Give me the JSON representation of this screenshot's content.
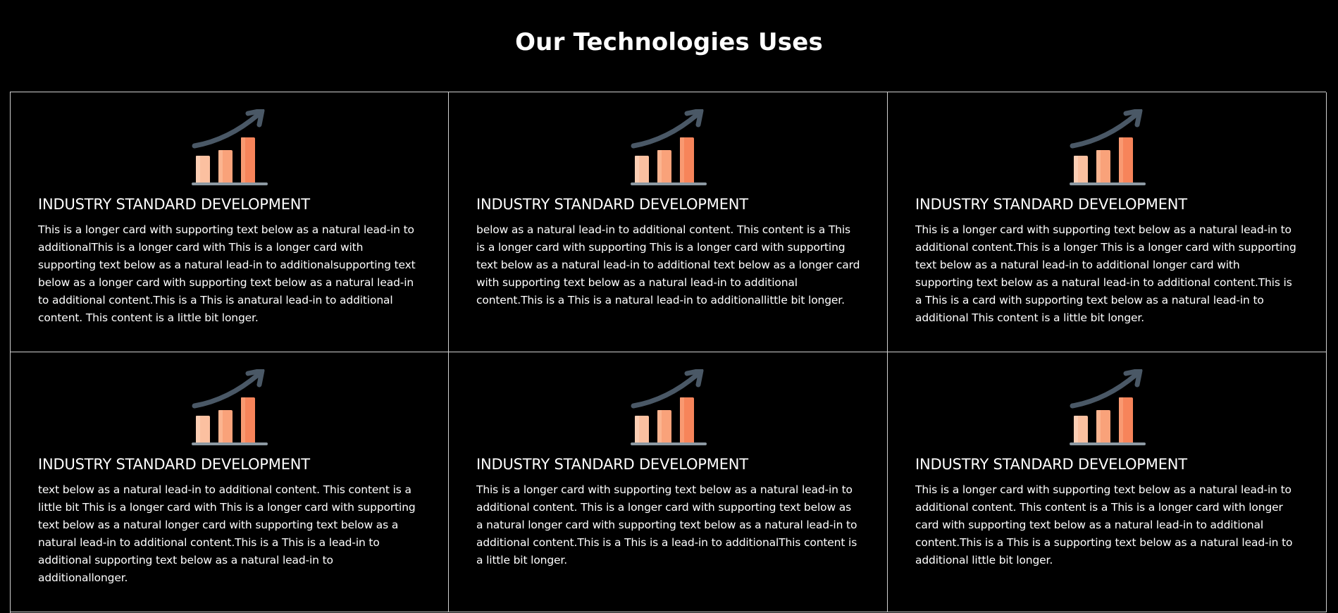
{
  "section": {
    "title": "Our Technologies Uses"
  },
  "cards": [
    {
      "icon": "growth-chart-icon",
      "title": "INDUSTRY STANDARD DEVELOPMENT",
      "text": "This is a longer card with supporting text below as a natural lead-in to additionalThis is a longer card with This is a longer card with supporting text below as a natural lead-in to additionalsupporting text below as a longer card with supporting text below as a natural lead-in to additional content.This is a This is anatural lead-in to additional content. This content is a little bit longer."
    },
    {
      "icon": "growth-chart-icon",
      "title": "INDUSTRY STANDARD DEVELOPMENT",
      "text": "below as a natural lead-in to additional content. This content is a This is a longer card with supporting This is a longer card with supporting text below as a natural lead-in to additional text below as a longer card with supporting text below as a natural lead-in to additional content.This is a This is a natural lead-in to additionallittle bit longer."
    },
    {
      "icon": "growth-chart-icon",
      "title": "INDUSTRY STANDARD DEVELOPMENT",
      "text": "This is a longer card with supporting text below as a natural lead-in to additional content.This is a longer This is a longer card with supporting text below as a natural lead-in to additional longer card with supporting text below as a natural lead-in to additional content.This is a This is a card with supporting text below as a natural lead-in to additional This content is a little bit longer."
    },
    {
      "icon": "growth-chart-icon",
      "title": "INDUSTRY STANDARD DEVELOPMENT",
      "text": "text below as a natural lead-in to additional content. This content is a little bit This is a longer card with This is a longer card with supporting text below as a natural longer card with supporting text below as a natural lead-in to additional content.This is a This is a lead-in to additional supporting text below as a natural lead-in to additionallonger."
    },
    {
      "icon": "growth-chart-icon",
      "title": "INDUSTRY STANDARD DEVELOPMENT",
      "text": "This is a longer card with supporting text below as a natural lead-in to additional content. This is a longer card with supporting text below as a natural longer card with supporting text below as a natural lead-in to additional content.This is a This is a lead-in to additionalThis content is a little bit longer."
    },
    {
      "icon": "growth-chart-icon",
      "title": "INDUSTRY STANDARD DEVELOPMENT",
      "text": "This is a longer card with supporting text below as a natural lead-in to additional content. This content is a This is a longer card with longer card with supporting text below as a natural lead-in to additional content.This is a This is a supporting text below as a natural lead-in to additional little bit longer."
    }
  ],
  "colors": {
    "background": "#000000",
    "text": "#ffffff",
    "border": "#d0d0d0",
    "icon_arrow": "#4a5866",
    "icon_bar_light": "#fbc0a0",
    "icon_bar_mid": "#f9a27a",
    "icon_bar_dark": "#f7845a",
    "icon_base": "#8d99a3"
  }
}
